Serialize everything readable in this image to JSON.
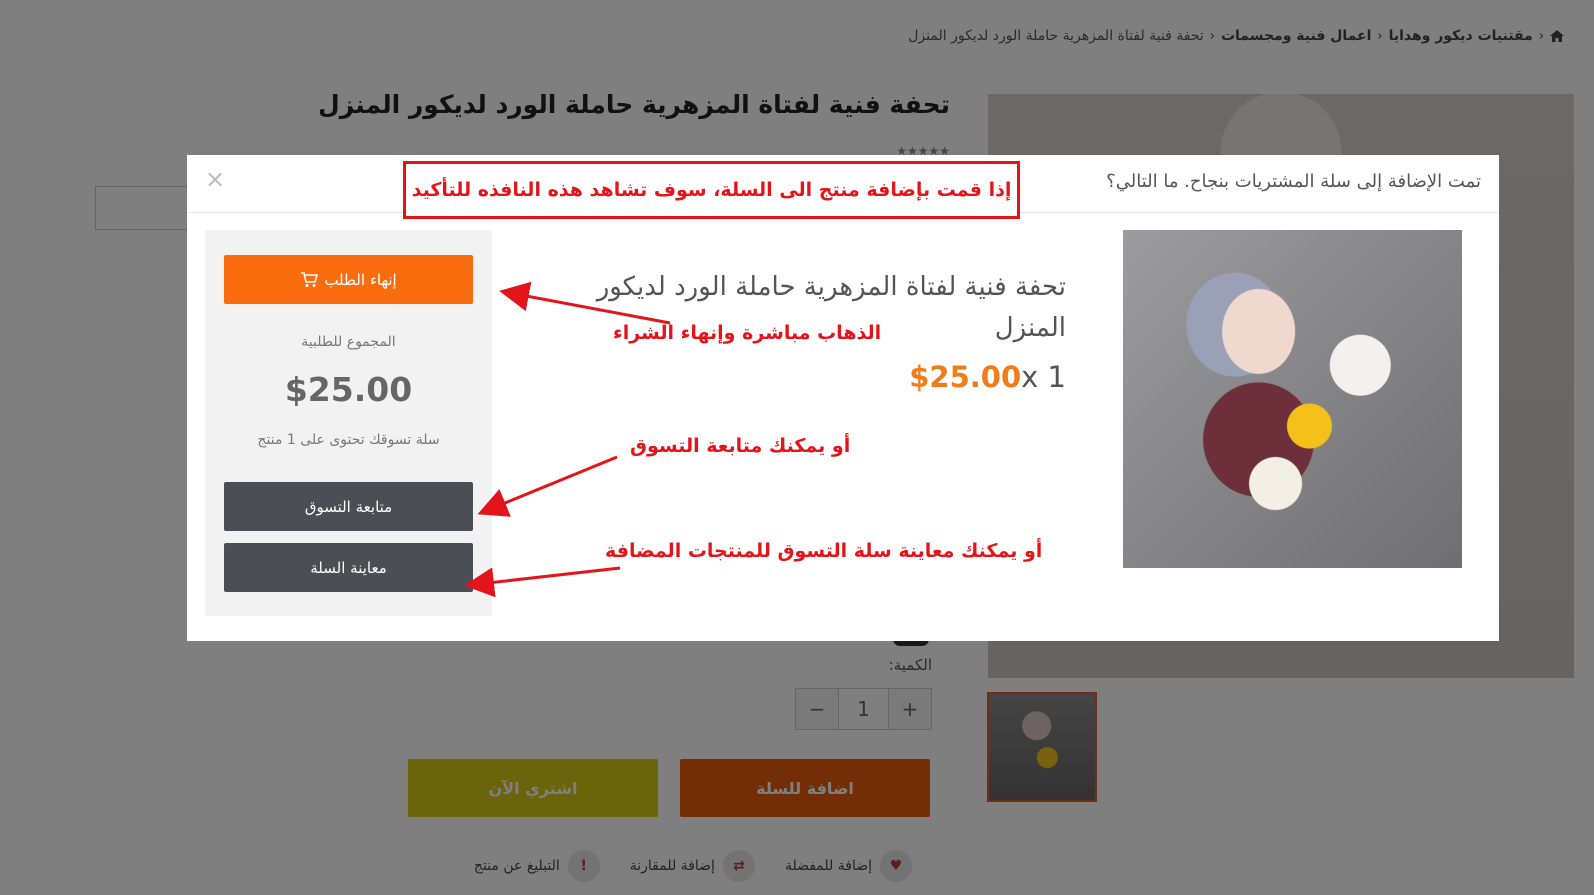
{
  "breadcrumb": {
    "items": [
      "مقتنيات ديكور وهدايا",
      "اعمال فنية ومجسمات",
      "تحفة فنية لفتاة المزهرية حاملة الورد لديكور المنزل"
    ]
  },
  "product": {
    "title": "تحفة فنية لفتاة المزهرية حاملة الورد لديكور المنزل",
    "quantity_label": "الكمية:",
    "quantity_value": "1",
    "add_to_cart": "اضافة للسلة",
    "buy_now": "اشتري الآن",
    "actions": {
      "wishlist": "إضافة للمفضلة",
      "compare": "إضافة للمقارنة",
      "report": "التبليغ عن منتج"
    }
  },
  "modal": {
    "title": "تمت الإضافة إلى سلة المشتريات بنجاح. ما التالي؟",
    "close": "×",
    "product_name": "تحفة فنية لفتاة المزهرية حاملة الورد لديكور المنزل",
    "quantity": "1",
    "multiplier": "x",
    "price": "$25.00",
    "checkout": "إنهاء الطلب",
    "total_label": "المجموع للطلبية",
    "total_value": "$25.00",
    "cart_count_text": "سلة تسوقك تحتوى على 1 منتج",
    "continue_shopping": "متابعة التسوق",
    "view_cart": "معاينة السلة"
  },
  "annotations": {
    "box": "إذا قمت بإضافة منتج الى السلة، سوف تشاهد هذه النافذه للتأكيد",
    "checkout_hint": "الذهاب مباشرة وإنهاء الشراء",
    "continue_hint": "أو يمكنك متابعة التسوق",
    "view_cart_hint": "أو يمكنك معاينة سلة التسوق للمنتجات المضافة"
  },
  "colors": {
    "accent_orange": "#fa6d0f",
    "price_orange": "#f07c1a",
    "dark_button": "#4b4f55",
    "annotation_red": "#e4141b",
    "buy_now_yellow": "#d4c916"
  },
  "icons": [
    "home-icon",
    "cart-icon",
    "heart-icon",
    "compare-icon",
    "exclamation-icon",
    "plus-icon",
    "minus-icon",
    "close-icon"
  ]
}
